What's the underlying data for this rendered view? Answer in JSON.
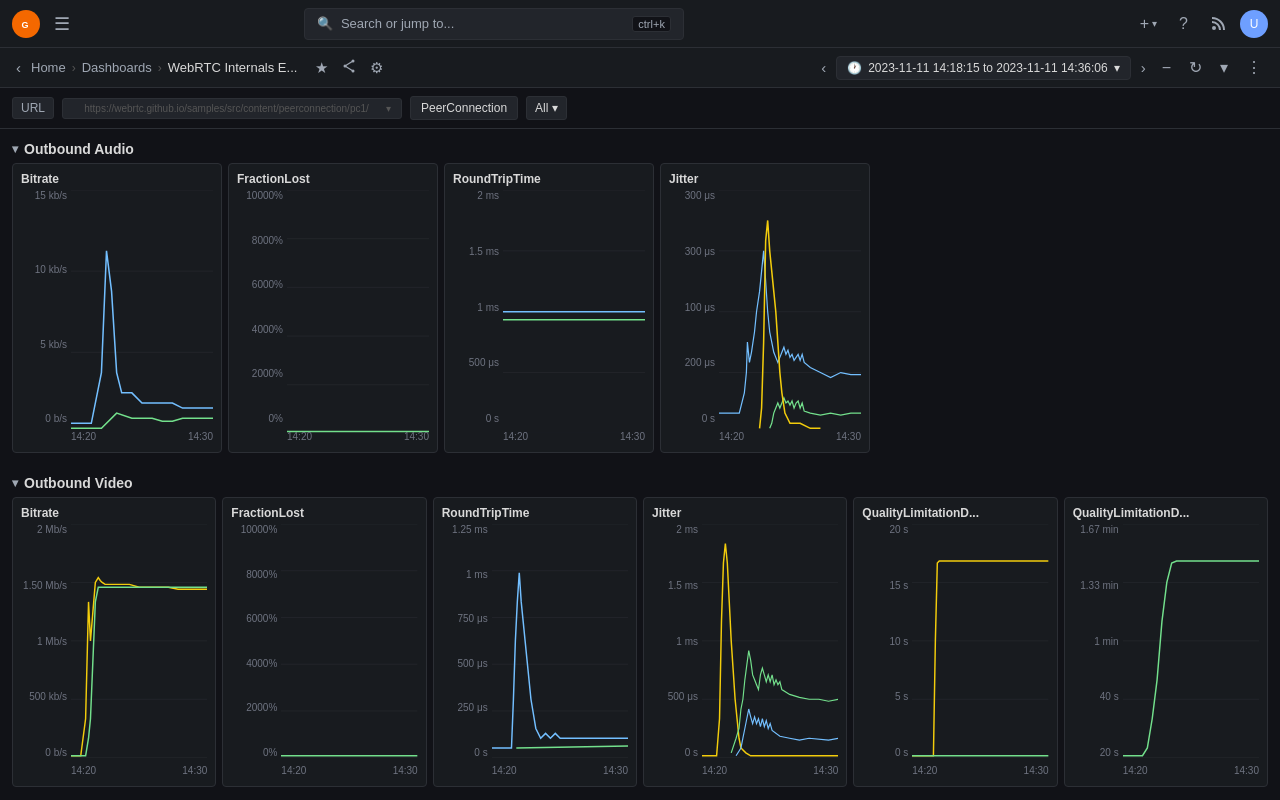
{
  "topnav": {
    "logo_letter": "G",
    "search_placeholder": "Search or jump to...",
    "shortcut": "ctrl+k",
    "add_label": "+",
    "help_label": "?",
    "rss_label": "📡",
    "avatar_label": "U"
  },
  "breadcrumb": {
    "home": "Home",
    "dashboards": "Dashboards",
    "current": "WebRTC Internals E...",
    "star": "★",
    "share": "⇄",
    "settings": "⚙",
    "time_range": "2023-11-11 14:18:15 to 2023-11-11 14:36:06",
    "zoom_out": "−",
    "refresh": "↻"
  },
  "urlbar": {
    "url_label": "URL",
    "url_value": "https://webrtc.github.io/samples/src/content/peerconnection/pc1/",
    "peer_connection": "PeerConnection",
    "all_label": "All ▾"
  },
  "outbound_audio": {
    "title": "Outbound Audio",
    "panels": [
      {
        "id": "audio-bitrate",
        "title": "Bitrate",
        "y_labels": [
          "15 kb/s",
          "10 kb/s",
          "5 kb/s",
          "0 b/s"
        ],
        "x_labels": [
          "14:20",
          "14:30"
        ],
        "chart_type": "audio_bitrate"
      },
      {
        "id": "audio-fractionlost",
        "title": "FractionLost",
        "y_labels": [
          "10000%",
          "8000%",
          "6000%",
          "4000%",
          "2000%",
          "0%"
        ],
        "x_labels": [
          "14:20",
          "14:30"
        ],
        "chart_type": "fraction_lost"
      },
      {
        "id": "audio-rtt",
        "title": "RoundTripTime",
        "y_labels": [
          "2 ms",
          "1.5 ms",
          "1 ms",
          "500 μs",
          "0 s"
        ],
        "x_labels": [
          "14:20",
          "14:30"
        ],
        "chart_type": "audio_rtt"
      },
      {
        "id": "audio-jitter",
        "title": "Jitter",
        "y_labels": [
          "300 μs",
          "300 μs",
          "100 μs",
          "200 μs",
          "0 s"
        ],
        "x_labels": [
          "14:20",
          "14:30"
        ],
        "chart_type": "audio_jitter"
      }
    ]
  },
  "outbound_video": {
    "title": "Outbound Video",
    "panels": [
      {
        "id": "video-bitrate",
        "title": "Bitrate",
        "y_labels": [
          "2 Mb/s",
          "1.50 Mb/s",
          "1 Mb/s",
          "500 kb/s",
          "0 b/s"
        ],
        "x_labels": [
          "14:20",
          "14:30"
        ],
        "chart_type": "video_bitrate"
      },
      {
        "id": "video-fractionlost",
        "title": "FractionLost",
        "y_labels": [
          "10000%",
          "8000%",
          "6000%",
          "4000%",
          "2000%",
          "0%"
        ],
        "x_labels": [
          "14:20",
          "14:30"
        ],
        "chart_type": "fraction_lost"
      },
      {
        "id": "video-rtt",
        "title": "RoundTripTime",
        "y_labels": [
          "1.25 ms",
          "1 ms",
          "750 μs",
          "500 μs",
          "250 μs",
          "0 s"
        ],
        "x_labels": [
          "14:20",
          "14:30"
        ],
        "chart_type": "video_rtt"
      },
      {
        "id": "video-jitter",
        "title": "Jitter",
        "y_labels": [
          "2 ms",
          "1.5 ms",
          "1 ms",
          "500 μs",
          "0 s"
        ],
        "x_labels": [
          "14:20",
          "14:30"
        ],
        "chart_type": "video_jitter"
      },
      {
        "id": "video-qlimit1",
        "title": "QualityLimitationD...",
        "y_labels": [
          "20 s",
          "15 s",
          "10 s",
          "5 s",
          "0 s"
        ],
        "x_labels": [
          "14:20",
          "14:30"
        ],
        "chart_type": "quality_limit1"
      },
      {
        "id": "video-qlimit2",
        "title": "QualityLimitationD...",
        "y_labels": [
          "1.67 min",
          "1.33 min",
          "1 min",
          "40 s",
          "20 s"
        ],
        "x_labels": [
          "14:20",
          "14:30"
        ],
        "chart_type": "quality_limit2"
      }
    ]
  }
}
